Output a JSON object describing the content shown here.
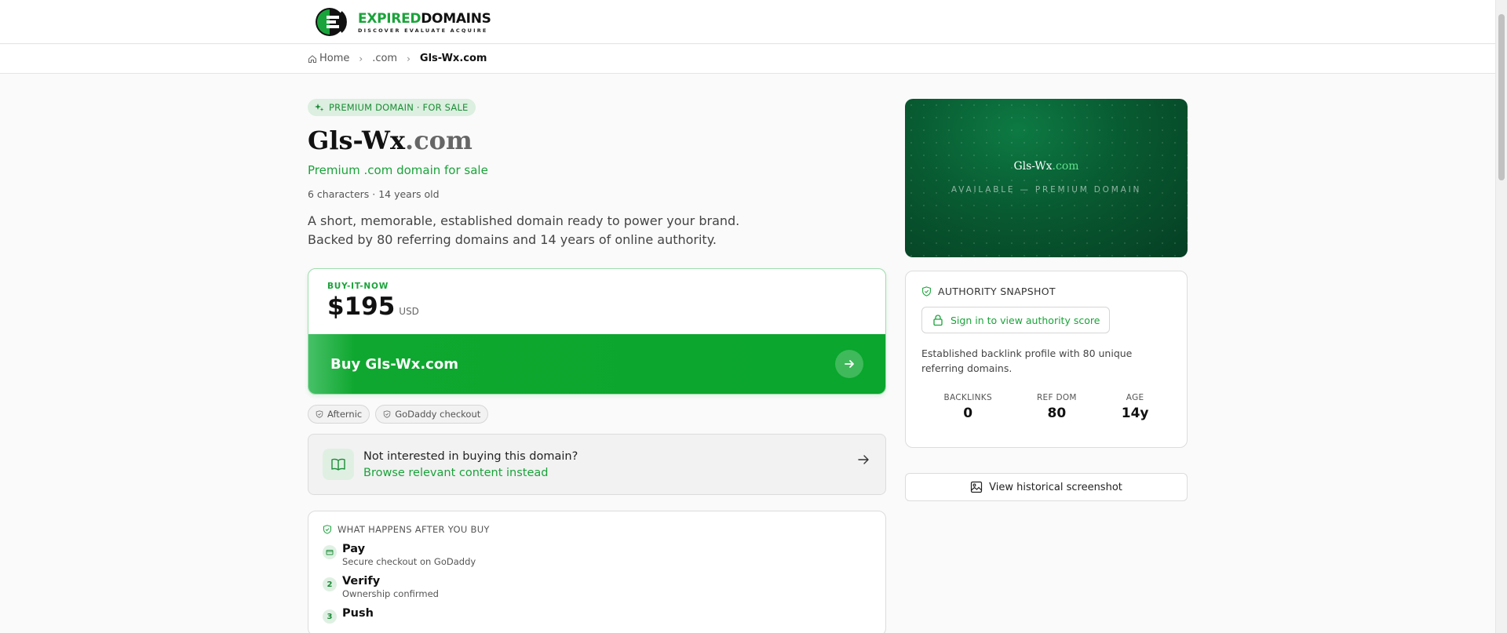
{
  "brand": {
    "name_green": "EXPIRED",
    "name_black": "DOMAINS",
    "tagline": "DISCOVER EVALUATE ACQUIRE"
  },
  "breadcrumb": {
    "home": "Home",
    "tld": ".com",
    "current": "Gls-Wx.com"
  },
  "domain": {
    "badge": "PREMIUM DOMAIN · FOR SALE",
    "name": "Gls-Wx",
    "tld": ".com",
    "subtitle": "Premium .com domain for sale",
    "meta": "6 characters · 14 years old",
    "description_line1": "A short, memorable, established domain ready to power your brand.",
    "description_line2": "Backed by 80 referring domains and 14 years of online authority."
  },
  "purchase": {
    "label": "BUY-IT-NOW",
    "price": "$195",
    "currency": "USD",
    "button_label": "Buy Gls-Wx.com",
    "chips": [
      "Afternic",
      "GoDaddy checkout"
    ]
  },
  "browse": {
    "question": "Not interested in buying this domain?",
    "link": "Browse relevant content instead"
  },
  "steps": {
    "heading": "WHAT HAPPENS AFTER YOU BUY",
    "items": [
      {
        "marker": "",
        "title": "Pay",
        "subtitle": "Secure checkout on GoDaddy"
      },
      {
        "marker": "2",
        "title": "Verify",
        "subtitle": "Ownership confirmed"
      },
      {
        "marker": "3",
        "title": "Push",
        "subtitle": ""
      }
    ]
  },
  "hero": {
    "name": "Gls-Wx",
    "tld": ".com",
    "subtitle": "AVAILABLE — PREMIUM DOMAIN"
  },
  "authority": {
    "heading": "AUTHORITY SNAPSHOT",
    "signin": "Sign in to view authority score",
    "description": "Established backlink profile with 80 unique referring domains.",
    "stats": [
      {
        "label": "BACKLINKS",
        "value": "0"
      },
      {
        "label": "REF DOM",
        "value": "80"
      },
      {
        "label": "AGE",
        "value": "14y"
      }
    ]
  },
  "history": {
    "button_label": "View historical screenshot"
  },
  "colors": {
    "accent": "#1aa33a",
    "hero_bg": "#085a31"
  },
  "icons": [
    "home-icon",
    "sparkle-icon",
    "arrow-right-icon",
    "shield-check-icon",
    "book-icon",
    "card-icon",
    "lock-icon",
    "image-icon"
  ]
}
